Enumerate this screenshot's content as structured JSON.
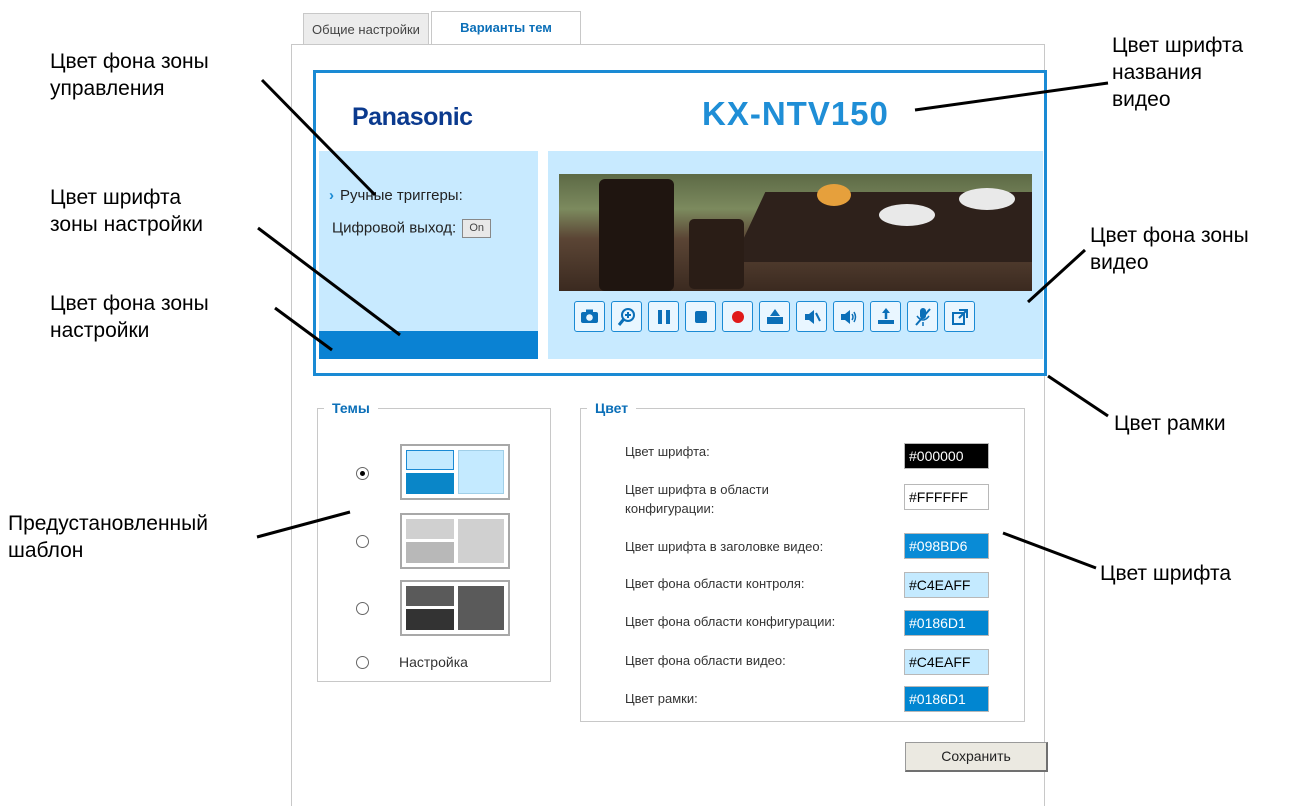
{
  "callouts": {
    "control_bg": "Цвет фона зоны\nуправления",
    "config_font": "Цвет шрифта\nзоны настройки",
    "config_bg": "Цвет фона зоны\nнастройки",
    "preset": "Предустановленный\nшаблон",
    "video_title_font": "Цвет шрифта\nназвания\nвидео",
    "video_bg": "Цвет фона зоны\nвидео",
    "frame": "Цвет рамки",
    "font": "Цвет шрифта"
  },
  "tabs": [
    "Общие настройки",
    "Варианты тем"
  ],
  "preview": {
    "brand": "Panasonic",
    "model": "KX-NTV150",
    "manual_triggers": "Ручные триггеры:",
    "digital_output": "Цифровой выход:",
    "on_label": "On"
  },
  "toolbar_icons": [
    "camera-icon",
    "zoom-in-icon",
    "pause-icon",
    "stop-icon",
    "record-icon",
    "snapshot-icon",
    "speaker-mute-icon",
    "speaker-icon",
    "mic-upload-icon",
    "mic-mute-icon",
    "popout-icon"
  ],
  "themes": {
    "legend": "Темы",
    "options": [
      {
        "selected": true,
        "colors": [
          "#c4eaff",
          "#0a86c8",
          "#c4eaff"
        ]
      },
      {
        "selected": false,
        "colors": [
          "#d0d0d0",
          "#b8b8b8",
          "#d0d0d0"
        ]
      },
      {
        "selected": false,
        "colors": [
          "#5a5a5a",
          "#333333",
          "#5a5a5a"
        ]
      }
    ],
    "custom_label": "Настройка"
  },
  "colors": {
    "legend": "Цвет",
    "rows": [
      {
        "label": "Цвет шрифта:",
        "value": "#000000",
        "bg": "#000000",
        "fg": "#ffffff"
      },
      {
        "label": "Цвет шрифта в области конфигурации:",
        "value": "#FFFFFF",
        "bg": "#ffffff",
        "fg": "#000000"
      },
      {
        "label": "Цвет шрифта в заголовке видео:",
        "value": "#098BD6",
        "bg": "#098bd6",
        "fg": "#ffffff"
      },
      {
        "label": "Цвет фона области контроля:",
        "value": "#C4EAFF",
        "bg": "#c4eaff",
        "fg": "#000000"
      },
      {
        "label": "Цвет фона области конфигурации:",
        "value": "#0186D1",
        "bg": "#0186d1",
        "fg": "#ffffff"
      },
      {
        "label": "Цвет фона области видео:",
        "value": "#C4EAFF",
        "bg": "#c4eaff",
        "fg": "#000000"
      },
      {
        "label": "Цвет рамки:",
        "value": "#0186D1",
        "bg": "#0186d1",
        "fg": "#ffffff"
      }
    ]
  },
  "save_label": "Сохранить"
}
